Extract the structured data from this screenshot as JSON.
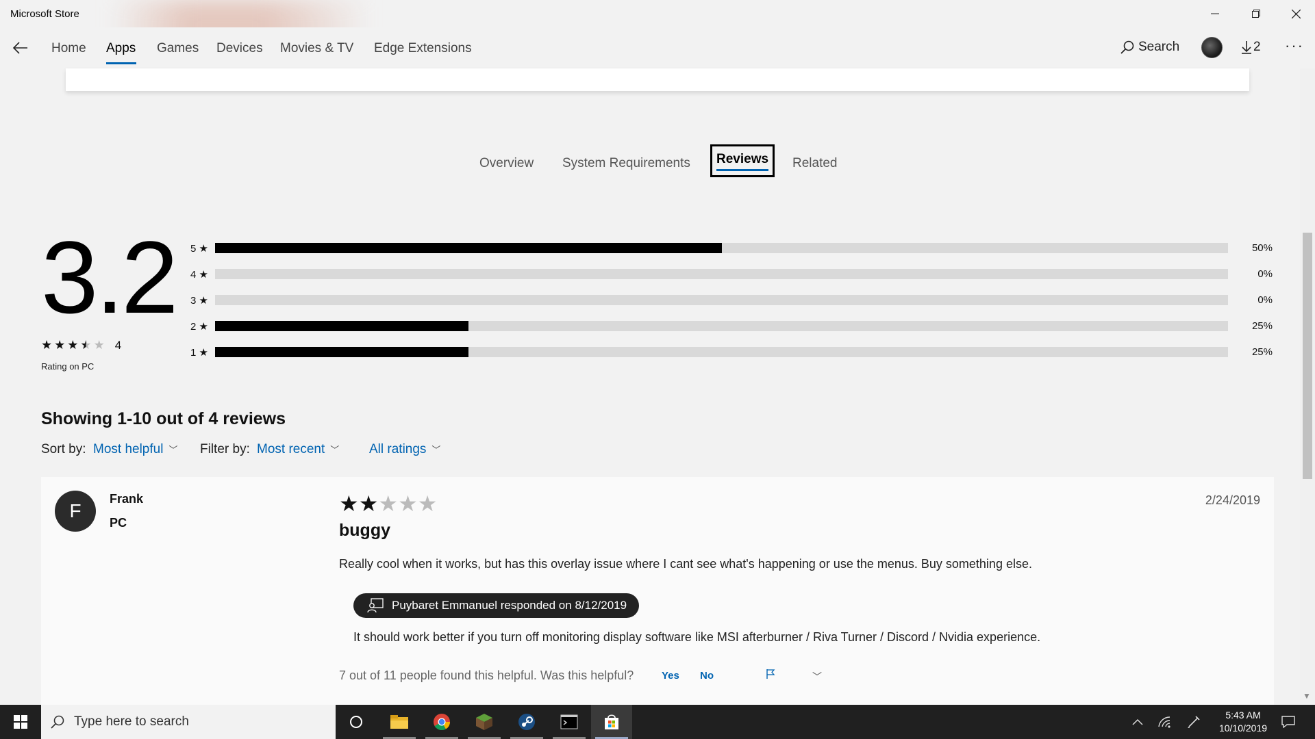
{
  "window": {
    "title": "Microsoft Store",
    "controls": {
      "minimize": "–",
      "maximize": "❐",
      "close": "✕"
    }
  },
  "nav": {
    "items": [
      "Home",
      "Apps",
      "Games",
      "Devices",
      "Movies & TV",
      "Edge Extensions"
    ],
    "active": "Apps",
    "search_label": "Search",
    "downloads_count": "2",
    "more": "···"
  },
  "tabs": {
    "items": [
      "Overview",
      "System Requirements",
      "Reviews",
      "Related"
    ],
    "active": "Reviews"
  },
  "rating": {
    "score": "3.2",
    "stars_value": 3.5,
    "count": "4",
    "caption": "Rating on PC",
    "breakdown": [
      {
        "label": "5 ★",
        "percent_text": "50%",
        "fraction": 0.5
      },
      {
        "label": "4 ★",
        "percent_text": "0%",
        "fraction": 0
      },
      {
        "label": "3 ★",
        "percent_text": "0%",
        "fraction": 0
      },
      {
        "label": "2 ★",
        "percent_text": "25%",
        "fraction": 0.25
      },
      {
        "label": "1 ★",
        "percent_text": "25%",
        "fraction": 0.25
      }
    ]
  },
  "reviews": {
    "showing": "Showing 1-10 out of 4 reviews",
    "sort_label": "Sort by:",
    "sort_value": "Most helpful",
    "filter_label": "Filter by:",
    "filter_value": "Most recent",
    "ratings_value": "All ratings",
    "items": [
      {
        "avatar_initial": "F",
        "name": "Frank",
        "device": "PC",
        "stars": 2,
        "date": "2/24/2019",
        "title": "buggy",
        "body": "Really cool when it works, but has this overlay issue where I cant see what's happening or use the menus. Buy something else.",
        "responder": "Puybaret Emmanuel responded on 8/12/2019",
        "response": "It should work better if you turn off monitoring display software like MSI afterburner / Riva Turner / Discord / Nvidia experience.",
        "helpful": "7 out of 11 people found this helpful. Was this helpful?",
        "yes": "Yes",
        "no": "No"
      }
    ]
  },
  "taskbar": {
    "search_placeholder": "Type here to search",
    "time": "5:43 AM",
    "date": "10/10/2019"
  },
  "colors": {
    "accent": "#0063b1",
    "taskbar": "#202020"
  }
}
